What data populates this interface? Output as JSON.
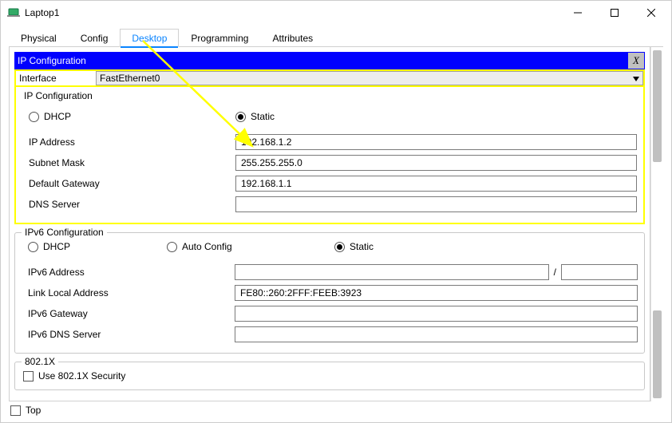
{
  "window": {
    "title": "Laptop1"
  },
  "tabs": [
    {
      "label": "Physical"
    },
    {
      "label": "Config"
    },
    {
      "label": "Desktop"
    },
    {
      "label": "Programming"
    },
    {
      "label": "Attributes"
    }
  ],
  "ipconfig": {
    "panelTitle": "IP Configuration",
    "closeLabel": "X",
    "interfaceLabel": "Interface",
    "interfaceValue": "FastEthernet0",
    "groupTitle": "IP Configuration",
    "dhcpLabel": "DHCP",
    "staticLabel": "Static",
    "ipAddressLabel": "IP Address",
    "ipAddressValue": "192.168.1.2",
    "subnetLabel": "Subnet Mask",
    "subnetValue": "255.255.255.0",
    "gatewayLabel": "Default Gateway",
    "gatewayValue": "192.168.1.1",
    "dnsLabel": "DNS Server",
    "dnsValue": ""
  },
  "ipv6": {
    "groupTitle": "IPv6 Configuration",
    "dhcpLabel": "DHCP",
    "autoLabel": "Auto Config",
    "staticLabel": "Static",
    "addrLabel": "IPv6 Address",
    "addrValue": "",
    "prefixValue": "",
    "slash": "/",
    "linkLocalLabel": "Link Local Address",
    "linkLocalValue": "FE80::260:2FFF:FEEB:3923",
    "gatewayLabel": "IPv6 Gateway",
    "gatewayValue": "",
    "dnsLabel": "IPv6 DNS Server",
    "dnsValue": ""
  },
  "dot1x": {
    "groupTitle": "802.1X",
    "useLabel": "Use 802.1X Security"
  },
  "footer": {
    "topLabel": "Top"
  }
}
